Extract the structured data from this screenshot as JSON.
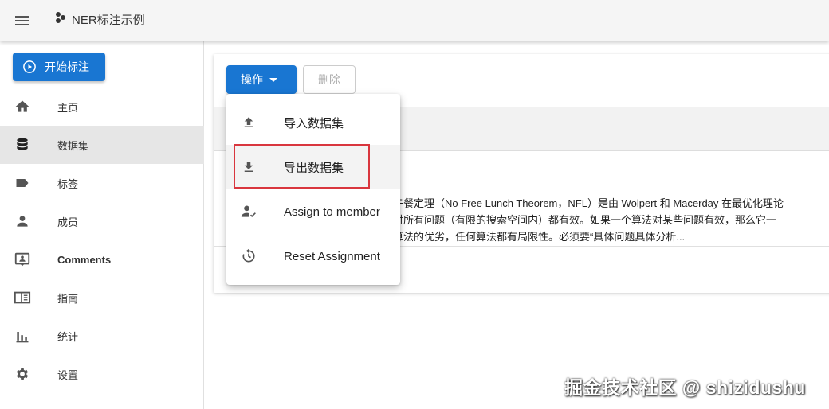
{
  "app": {
    "title": "NER标注示例"
  },
  "sidebar": {
    "start_label": "开始标注",
    "items": [
      {
        "label": "主页",
        "icon": "home-icon"
      },
      {
        "label": "数据集",
        "icon": "database-icon",
        "active": true
      },
      {
        "label": "标签",
        "icon": "label-icon"
      },
      {
        "label": "成员",
        "icon": "person-icon"
      },
      {
        "label": "Comments",
        "icon": "comment-icon"
      },
      {
        "label": "指南",
        "icon": "book-icon"
      },
      {
        "label": "统计",
        "icon": "chart-icon"
      },
      {
        "label": "设置",
        "icon": "gear-icon"
      }
    ]
  },
  "toolbar": {
    "ops_label": "操作",
    "delete_label": "删除"
  },
  "dropdown": {
    "items": [
      {
        "label": "导入数据集",
        "icon": "upload-icon"
      },
      {
        "label": "导出数据集",
        "icon": "download-icon"
      },
      {
        "label": "Assign to member",
        "icon": "person-check-icon"
      },
      {
        "label": "Reset Assignment",
        "icon": "reset-icon"
      }
    ]
  },
  "table": {
    "row_text": [
      "费午餐定理（No Free Lunch Theorem，NFL）是由 Wolpert 和 Macerday 在最优化理论",
      "法对所有问题（有限的搜索空间内）都有效。如果一个算法对某些问题有效，那么它一",
      "论算法的优劣，任何算法都有局限性。必须要“具体问题具体分析..."
    ]
  },
  "watermark": "掘金技术社区 @ shizidushu",
  "colors": {
    "primary": "#1976d2",
    "highlight": "#d9363e"
  }
}
